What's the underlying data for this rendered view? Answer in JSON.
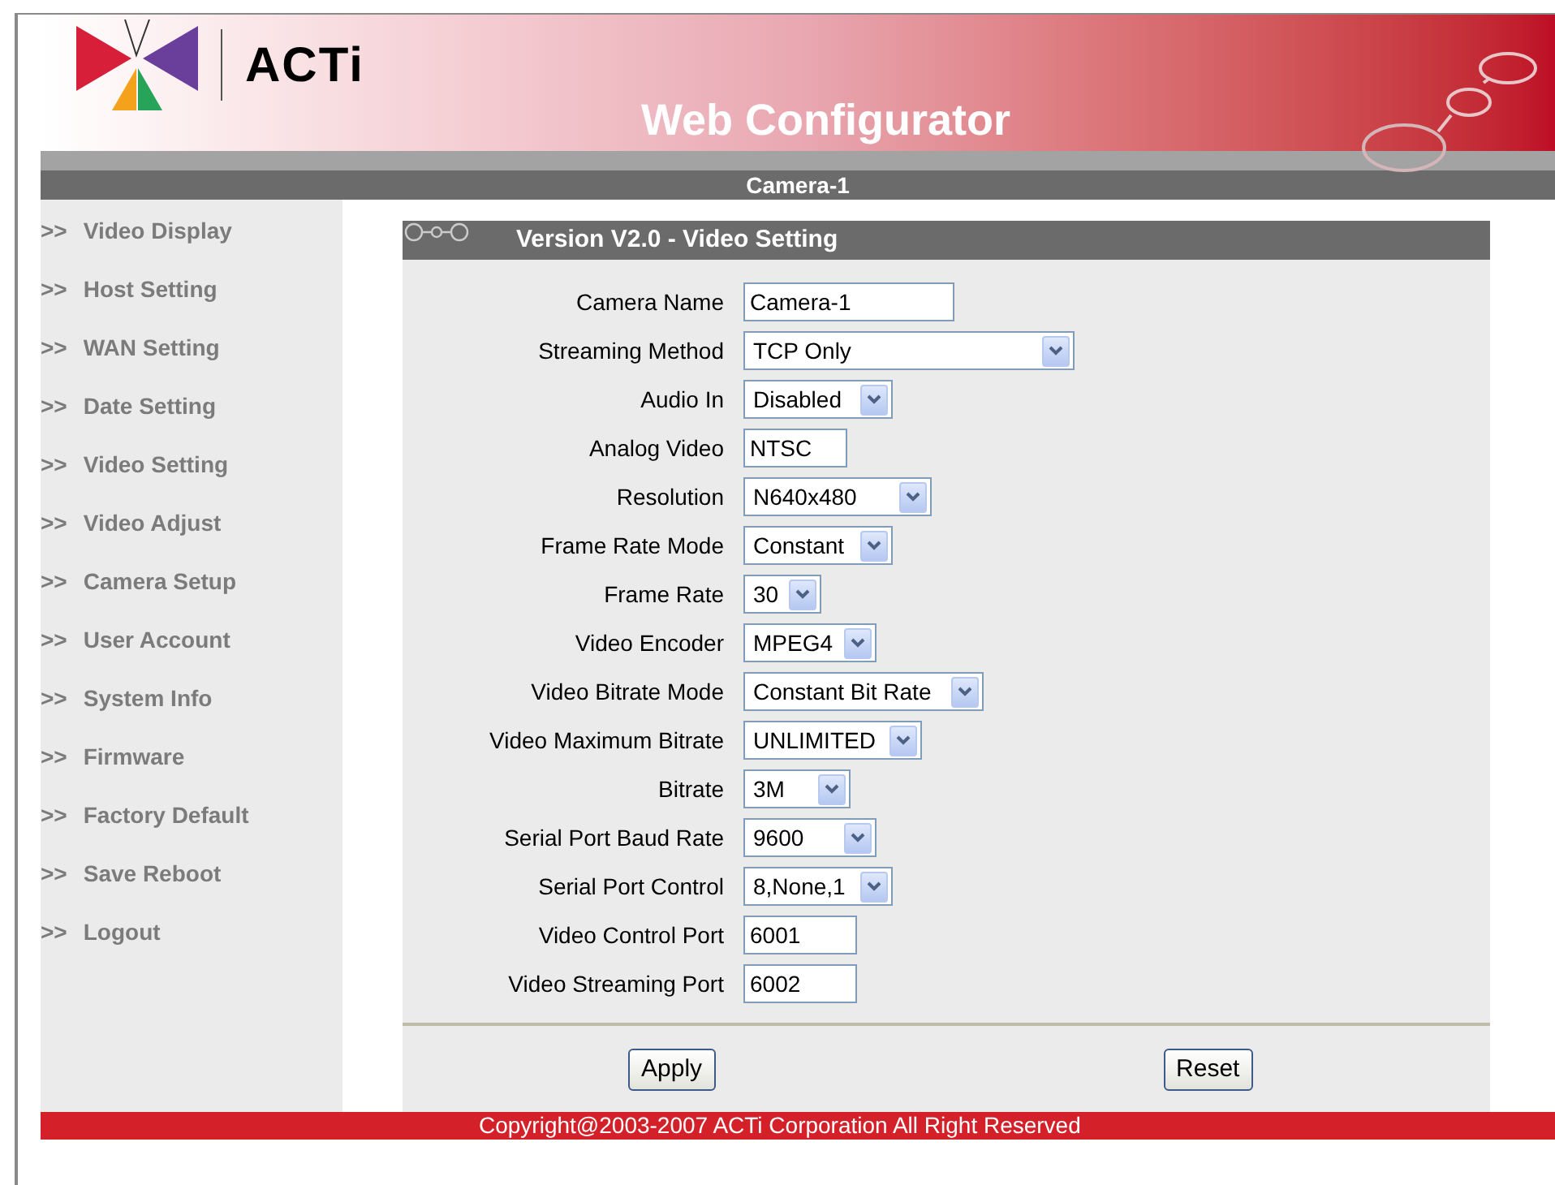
{
  "header": {
    "logo_text": "ACTi",
    "title": "Web Configurator"
  },
  "camera_bar": {
    "title": "Camera-1"
  },
  "sidebar": {
    "items": [
      {
        "marker": ">>",
        "label": "Video Display"
      },
      {
        "marker": ">>",
        "label": "Host Setting"
      },
      {
        "marker": ">>",
        "label": "WAN Setting"
      },
      {
        "marker": ">>",
        "label": "Date Setting"
      },
      {
        "marker": ">>",
        "label": "Video Setting"
      },
      {
        "marker": ">>",
        "label": "Video Adjust"
      },
      {
        "marker": ">>",
        "label": "Camera Setup"
      },
      {
        "marker": ">>",
        "label": "User Account"
      },
      {
        "marker": ">>",
        "label": "System Info"
      },
      {
        "marker": ">>",
        "label": "Firmware"
      },
      {
        "marker": ">>",
        "label": "Factory Default"
      },
      {
        "marker": ">>",
        "label": "Save Reboot"
      },
      {
        "marker": ">>",
        "label": "Logout"
      }
    ]
  },
  "panel": {
    "title": "Version V2.0 - Video Setting",
    "fields": [
      {
        "label": "Camera Name",
        "kind": "text",
        "value": "Camera-1"
      },
      {
        "label": "Streaming Method",
        "kind": "select",
        "value": "TCP Only"
      },
      {
        "label": "Audio In",
        "kind": "select",
        "value": "Disabled"
      },
      {
        "label": "Analog Video",
        "kind": "text",
        "value": "NTSC"
      },
      {
        "label": "Resolution",
        "kind": "select",
        "value": "N640x480"
      },
      {
        "label": "Frame Rate Mode",
        "kind": "select",
        "value": "Constant"
      },
      {
        "label": "Frame Rate",
        "kind": "select",
        "value": "30"
      },
      {
        "label": "Video Encoder",
        "kind": "select",
        "value": "MPEG4"
      },
      {
        "label": "Video Bitrate Mode",
        "kind": "select",
        "value": "Constant Bit Rate"
      },
      {
        "label": "Video Maximum Bitrate",
        "kind": "select",
        "value": "UNLIMITED"
      },
      {
        "label": "Bitrate",
        "kind": "select",
        "value": "3M"
      },
      {
        "label": "Serial Port Baud Rate",
        "kind": "select",
        "value": "9600"
      },
      {
        "label": "Serial Port Control",
        "kind": "select",
        "value": "8,None,1"
      },
      {
        "label": "Video Control Port",
        "kind": "text",
        "value": "6001"
      },
      {
        "label": "Video Streaming Port",
        "kind": "text",
        "value": "6002"
      }
    ],
    "buttons": [
      "Apply",
      "Reset"
    ]
  },
  "footer": {
    "text": "Copyright@2003-2007 ACTi Corporation All Right Reserved"
  }
}
